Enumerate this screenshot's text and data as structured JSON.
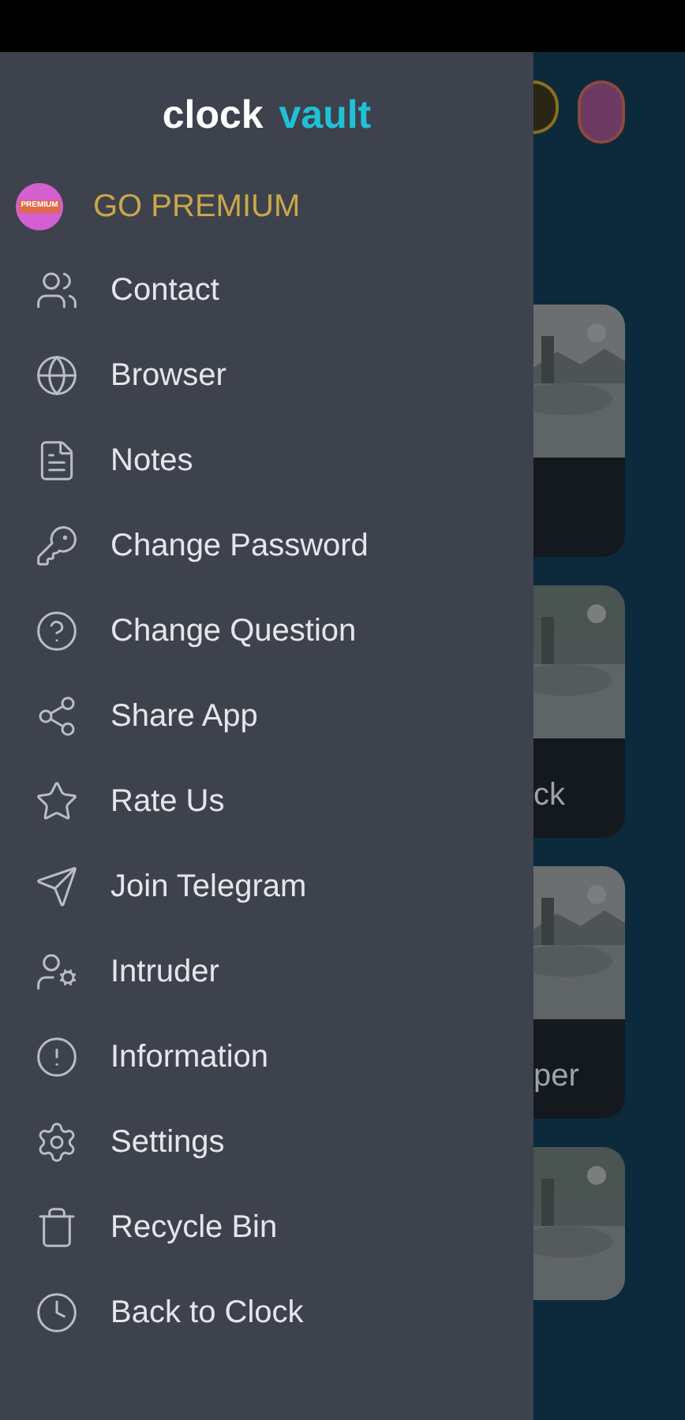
{
  "drawer": {
    "logo": {
      "first": "clock",
      "second": "vault"
    },
    "premium": {
      "label": "GO PREMIUM",
      "badge": "PREMIUM"
    },
    "items": [
      {
        "label": "Contact",
        "kind": "users"
      },
      {
        "label": "Browser",
        "kind": "globe"
      },
      {
        "label": "Notes",
        "kind": "note"
      },
      {
        "label": "Change Password",
        "kind": "key"
      },
      {
        "label": "Change Question",
        "kind": "help"
      },
      {
        "label": "Share App",
        "kind": "share"
      },
      {
        "label": "Rate Us",
        "kind": "star"
      },
      {
        "label": "Join Telegram",
        "kind": "send"
      },
      {
        "label": "Intruder",
        "kind": "intruder"
      },
      {
        "label": "Information",
        "kind": "info"
      },
      {
        "label": "Settings",
        "kind": "settings"
      },
      {
        "label": "Recycle Bin",
        "kind": "trash"
      },
      {
        "label": "Back to Clock",
        "kind": "clock"
      }
    ]
  },
  "background": {
    "cards": [
      {
        "kind": "picture",
        "caption_bar": true
      },
      {
        "kind": "picture",
        "caption_bar": true,
        "caption": "ck"
      },
      {
        "kind": "picture",
        "caption_bar": true,
        "caption": "per"
      },
      {
        "kind": "picture",
        "caption_bar": false
      }
    ]
  }
}
